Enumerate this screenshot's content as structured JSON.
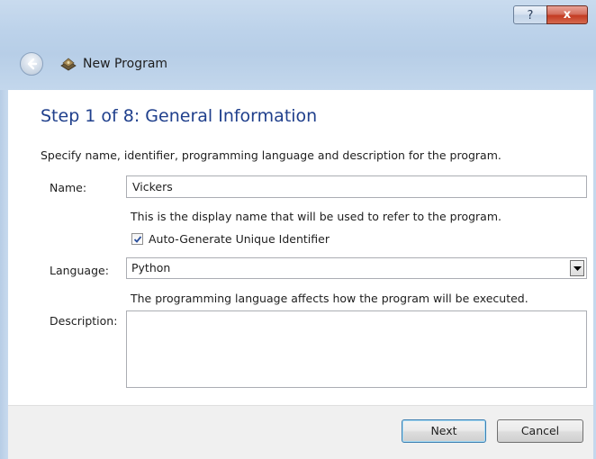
{
  "window": {
    "title": "New Program",
    "help_label": "?",
    "close_label": "x"
  },
  "wizard": {
    "step_title": "Step 1 of 8: General Information",
    "description": "Specify name, identifier, programming language and description for the program."
  },
  "form": {
    "name_label": "Name:",
    "name_value": "Vickers",
    "name_hint": "This is the display name that will be used to refer to the program.",
    "auto_id_label": "Auto-Generate Unique Identifier",
    "auto_id_checked": true,
    "language_label": "Language:",
    "language_value": "Python",
    "language_hint": "The programming language affects how the program will be executed.",
    "description_label": "Description:",
    "description_value": ""
  },
  "buttons": {
    "next": "Next",
    "cancel": "Cancel"
  },
  "icons": {
    "back": "back-arrow-icon",
    "app": "program-icon",
    "checkmark": "checkmark-icon",
    "dropdown": "chevron-down-icon"
  },
  "colors": {
    "titlebar": "#bcd2ea",
    "step_title": "#1f3f8c",
    "close_button": "#c43a22",
    "footer": "#f0f0f0"
  }
}
